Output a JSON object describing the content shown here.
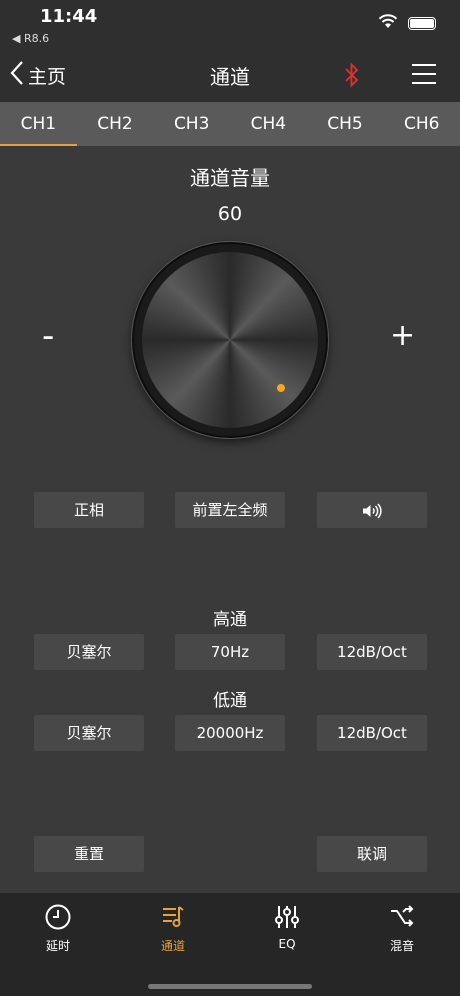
{
  "status": {
    "time": "11:44",
    "back_app": "◀ R8.6"
  },
  "nav": {
    "back_label": "主页",
    "title": "通道"
  },
  "tabs": [
    {
      "label": "CH1"
    },
    {
      "label": "CH2"
    },
    {
      "label": "CH3"
    },
    {
      "label": "CH4"
    },
    {
      "label": "CH5"
    },
    {
      "label": "CH6"
    }
  ],
  "volume": {
    "title": "通道音量",
    "value": "60",
    "minus": "-",
    "plus": "+"
  },
  "controls": {
    "phase": "正相",
    "channel_source": "前置左全频",
    "speaker_icon": "volume-icon"
  },
  "highpass": {
    "label": "高通",
    "type": "贝塞尔",
    "freq": "70Hz",
    "slope": "12dB/Oct"
  },
  "lowpass": {
    "label": "低通",
    "type": "贝塞尔",
    "freq": "20000Hz",
    "slope": "12dB/Oct"
  },
  "actions": {
    "reset": "重置",
    "link": "联调"
  },
  "bottom_tabs": [
    {
      "label": "延时",
      "icon": "clock-icon"
    },
    {
      "label": "通道",
      "icon": "channel-icon"
    },
    {
      "label": "EQ",
      "icon": "equalizer-icon"
    },
    {
      "label": "混音",
      "icon": "mix-icon"
    }
  ],
  "colors": {
    "accent": "#e6a23c",
    "bluetooth": "#e0312f",
    "knob_dot": "#f5a623"
  }
}
